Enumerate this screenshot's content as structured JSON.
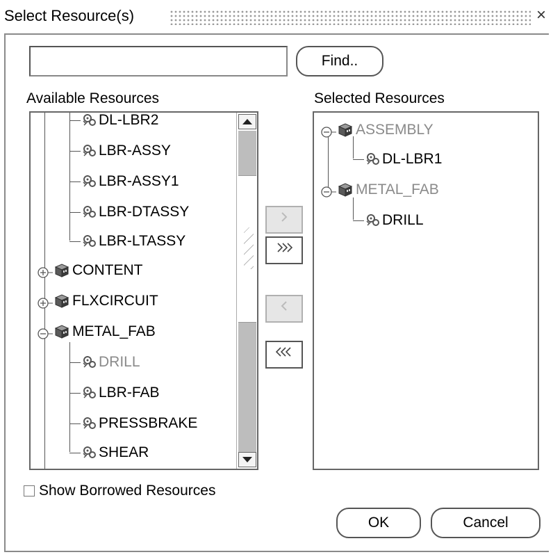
{
  "window": {
    "title": "Select Resource(s)",
    "close_glyph": "×"
  },
  "search": {
    "value": "",
    "find_label": "Find.."
  },
  "available": {
    "label": "Available Resources",
    "items": [
      {
        "label": "DL-LBR2",
        "type": "resource",
        "muted": false
      },
      {
        "label": "LBR-ASSY",
        "type": "resource",
        "muted": false
      },
      {
        "label": "LBR-ASSY1",
        "type": "resource",
        "muted": false
      },
      {
        "label": "LBR-DTASSY",
        "type": "resource",
        "muted": false
      },
      {
        "label": "LBR-LTASSY",
        "type": "resource",
        "muted": false
      },
      {
        "label": "CONTENT",
        "type": "department",
        "expanded": false
      },
      {
        "label": "FLXCIRCUIT",
        "type": "department",
        "expanded": false
      },
      {
        "label": "METAL_FAB",
        "type": "department",
        "expanded": true
      },
      {
        "label": "DRILL",
        "type": "resource",
        "muted": true
      },
      {
        "label": "LBR-FAB",
        "type": "resource",
        "muted": false
      },
      {
        "label": "PRESSBRAKE",
        "type": "resource",
        "muted": false
      },
      {
        "label": "SHEAR",
        "type": "resource",
        "muted": false
      }
    ]
  },
  "selected": {
    "label": "Selected Resources",
    "items": [
      {
        "label": "ASSEMBLY",
        "type": "department",
        "expanded": true,
        "muted": true
      },
      {
        "label": "DL-LBR1",
        "type": "resource",
        "muted": false
      },
      {
        "label": "METAL_FAB",
        "type": "department",
        "expanded": true,
        "muted": true
      },
      {
        "label": "DRILL",
        "type": "resource",
        "muted": false
      }
    ]
  },
  "shuttle": {
    "move": ">",
    "move_all": ">>",
    "remove": "<",
    "remove_all": "<<"
  },
  "options": {
    "show_borrowed_label": "Show Borrowed Resources",
    "show_borrowed_checked": false
  },
  "footer": {
    "ok_label": "OK",
    "cancel_label": "Cancel"
  },
  "colors": {
    "muted_text": "#8a8a8a",
    "resource_icon": "#555555",
    "department_icon": "#3a3a3a"
  }
}
